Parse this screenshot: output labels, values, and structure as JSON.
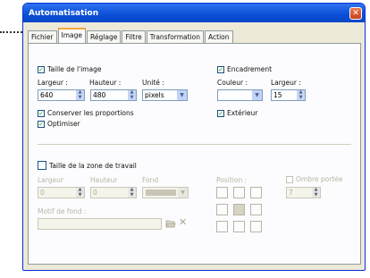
{
  "window": {
    "title": "Automatisation",
    "close_glyph": "✕"
  },
  "tabs": [
    {
      "label": "Fichier"
    },
    {
      "label": "Image"
    },
    {
      "label": "Réglage"
    },
    {
      "label": "Filtre"
    },
    {
      "label": "Transformation"
    },
    {
      "label": "Action"
    }
  ],
  "image_size": {
    "checkbox_label": "Taille de l'image",
    "width_label": "Largeur :",
    "width_value": "640",
    "height_label": "Hauteur :",
    "height_value": "480",
    "unit_label": "Unité :",
    "unit_value": "pixels",
    "keep_ratio_label": "Conserver les proportions",
    "optimize_label": "Optimiser"
  },
  "frame": {
    "checkbox_label": "Encadrement",
    "color_label": "Couleur :",
    "width_label": "Largeur :",
    "width_value": "15",
    "exterior_label": "Extérieur"
  },
  "canvas": {
    "checkbox_label": "Taille de la zone de travail",
    "width_label": "Largeur",
    "width_value": "0",
    "height_label": "Hauteur",
    "height_value": "0",
    "bg_label": "Fond",
    "position_label": "Position :",
    "shadow_label": "Ombre portée",
    "shadow_value": "7",
    "pattern_label": "Motif de fond :",
    "delete_glyph": "✕"
  }
}
